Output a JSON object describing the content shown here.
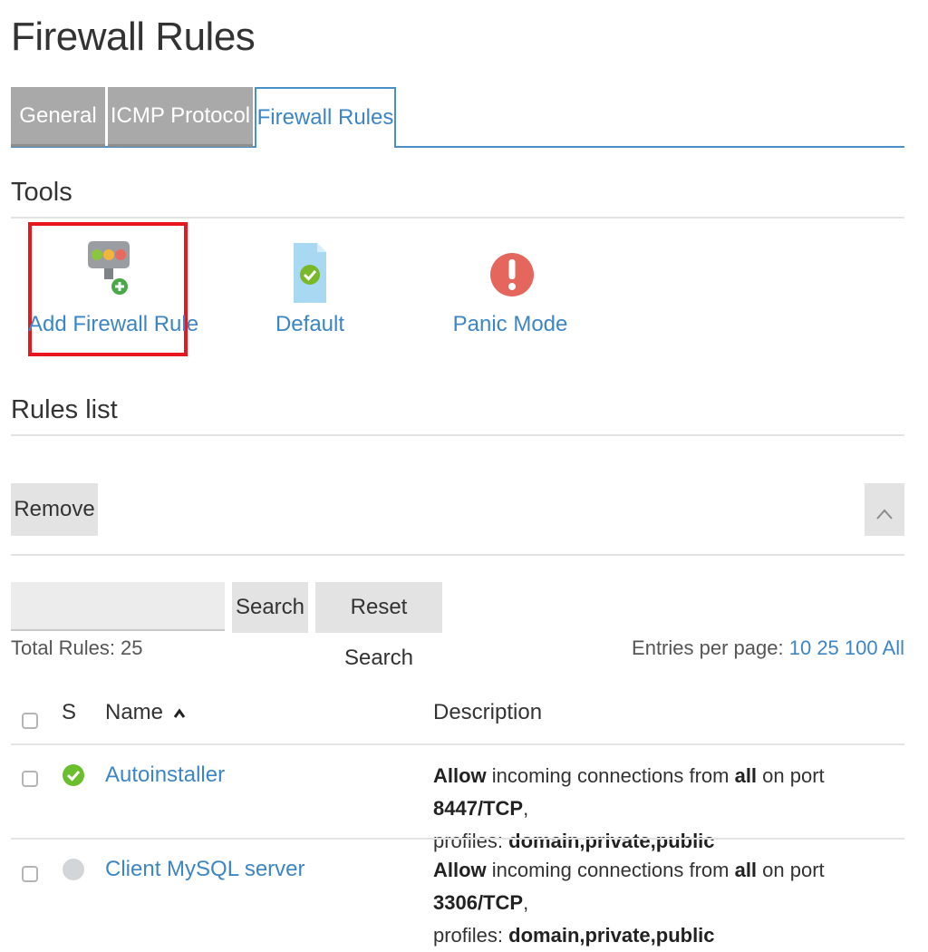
{
  "page": {
    "title": "Firewall Rules"
  },
  "tabs": [
    {
      "label": "General",
      "active": false
    },
    {
      "label": "ICMP Protocol",
      "active": false
    },
    {
      "label": "Firewall Rules",
      "active": true
    }
  ],
  "tools": {
    "heading": "Tools",
    "items": [
      {
        "label": "Add Firewall Rule",
        "icon": "firewall-add-icon",
        "highlighted": true
      },
      {
        "label": "Default",
        "icon": "document-check-icon"
      },
      {
        "label": "Panic Mode",
        "icon": "exclamation-icon"
      }
    ]
  },
  "rules_list": {
    "heading": "Rules list",
    "remove_label": "Remove",
    "collapse_icon": "chevron-up-icon",
    "search": {
      "value": "",
      "button_label": "Search",
      "reset_label": "Reset Search"
    },
    "total_label": "Total Rules: 25",
    "entries_label": "Entries per page:",
    "entries_options": [
      "10",
      "25",
      "100",
      "All"
    ],
    "columns": {
      "status": "S",
      "name": "Name",
      "name_sort_icon": "sort-up-icon",
      "description": "Description"
    },
    "rows": [
      {
        "name": "Autoinstaller",
        "status": "enabled",
        "desc": {
          "action": "Allow",
          "t1": " incoming connections from ",
          "from": "all",
          "t2": " on port ",
          "port": "8447/TCP",
          "t3": ",",
          "t4": "profiles: ",
          "profiles": "domain,private,public"
        }
      },
      {
        "name": "Client MySQL server",
        "status": "disabled",
        "desc": {
          "action": "Allow",
          "t1": " incoming connections from ",
          "from": "all",
          "t2": " on port ",
          "port": "3306/TCP",
          "t3": ",",
          "t4": "profiles: ",
          "profiles": "domain,private,public"
        }
      }
    ]
  },
  "colors": {
    "link": "#3d86c6",
    "highlight": "#e8161d",
    "tab_inactive": "#a9a9a9",
    "status_ok": "#6bbe2e",
    "status_off": "#d3d6d9",
    "panic": "#e5665d"
  }
}
